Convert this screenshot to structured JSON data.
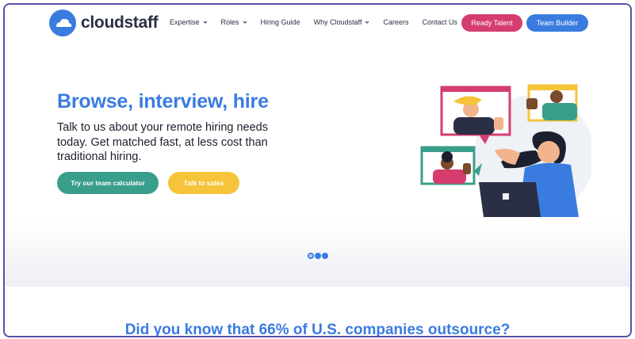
{
  "brand": {
    "name": "cloudstaff",
    "logo_icon": "cloud-icon",
    "primary_color": "#3a7be0"
  },
  "nav": {
    "items": [
      {
        "label": "Expertise",
        "dropdown": true
      },
      {
        "label": "Roles",
        "dropdown": true
      },
      {
        "label": "Hiring Guide",
        "dropdown": false
      },
      {
        "label": "Why Cloudstaff",
        "dropdown": true
      },
      {
        "label": "Careers",
        "dropdown": false
      },
      {
        "label": "Contact Us",
        "dropdown": false
      }
    ],
    "ready_talent": "Ready Talent",
    "team_builder": "Team Builder"
  },
  "hero": {
    "title": "Browse, interview, hire",
    "subtitle": "Talk to us about your remote hiring needs today. Get matched fast, at less cost than traditional hiring.",
    "cta_calculator": "Try our team calculator",
    "cta_sales": "Talk to sales"
  },
  "carousel": {
    "pages": 3,
    "active": 1
  },
  "stats": {
    "heading": "Did you know that 66% of U.S. companies outsource?"
  },
  "colors": {
    "ready_talent_bg": "#d63d6f",
    "calculator_bg": "#3a9e8c",
    "sales_bg": "#f5c43a",
    "frame_border": "#5b4fa8"
  }
}
